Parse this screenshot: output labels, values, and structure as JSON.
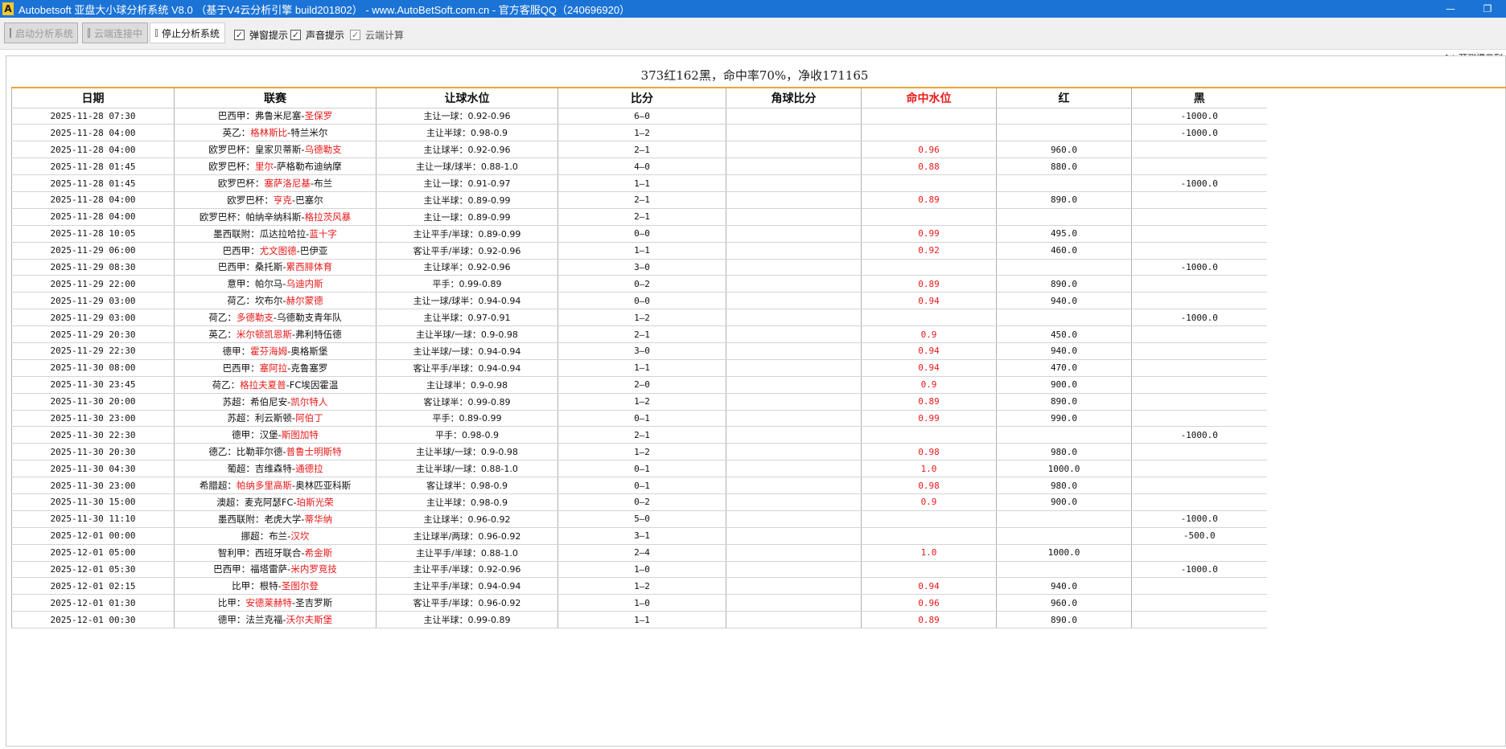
{
  "window": {
    "icon_letter": "A",
    "title": "Autobetsoft 亚盘大小球分析系统 V8.0  （基于V4云分析引擎 build201802） - www.AutoBetSoft.com.cn - 官方客服QQ（240696920）",
    "minimize_glyph": "—",
    "restore_glyph": "❐"
  },
  "toolbar": {
    "start_label": "启动分析系统",
    "cloud_label": "云端连接中",
    "stop_label": "停止分析系统",
    "popup_label": "弹窗提示",
    "sound_label": "声音提示",
    "cloud_calc_label": "云端计算"
  },
  "hint_text": "[ * 预测提示列",
  "summary": "373红162黑，命中率70%，净收171165",
  "columns": [
    "日期",
    "联赛",
    "让球水位",
    "比分",
    "角球比分",
    "命中水位",
    "红",
    "黑"
  ],
  "rows": [
    {
      "date": "2025-11-28 07:30",
      "league": "巴西甲：",
      "home": "弗鲁米尼塞",
      "away": "圣保罗",
      "red": "away",
      "handicap": "主让一球：0.92-0.96",
      "score": "6—0",
      "hit": "",
      "win": "",
      "loss": "-1000.0"
    },
    {
      "date": "2025-11-28 04:00",
      "league": "英乙：",
      "home": "格林斯比",
      "away": "特兰米尔",
      "red": "home",
      "handicap": "主让半球：0.98-0.9",
      "score": "1—2",
      "hit": "",
      "win": "",
      "loss": "-1000.0"
    },
    {
      "date": "2025-11-28 04:00",
      "league": "欧罗巴杯：",
      "home": "皇家贝蒂斯",
      "away": "乌德勒支",
      "red": "away",
      "handicap": "主让球半：0.92-0.96",
      "score": "2—1",
      "hit": "0.96",
      "win": "960.0",
      "loss": ""
    },
    {
      "date": "2025-11-28 01:45",
      "league": "欧罗巴杯：",
      "home": "里尔",
      "away": "萨格勒布迪纳摩",
      "red": "home",
      "handicap": "主让一球/球半：0.88-1.0",
      "score": "4—0",
      "hit": "0.88",
      "win": "880.0",
      "loss": ""
    },
    {
      "date": "2025-11-28 01:45",
      "league": "欧罗巴杯：",
      "home": "塞萨洛尼基",
      "away": "布兰",
      "red": "home",
      "handicap": "主让一球：0.91-0.97",
      "score": "1—1",
      "hit": "",
      "win": "",
      "loss": "-1000.0"
    },
    {
      "date": "2025-11-28 04:00",
      "league": "欧罗巴杯：",
      "home": "亨克",
      "away": "巴塞尔",
      "red": "home",
      "handicap": "主让半球：0.89-0.99",
      "score": "2—1",
      "hit": "0.89",
      "win": "890.0",
      "loss": ""
    },
    {
      "date": "2025-11-28 04:00",
      "league": "欧罗巴杯：",
      "home": "帕纳辛纳科斯",
      "away": "格拉茨风暴",
      "red": "away",
      "handicap": "主让一球：0.89-0.99",
      "score": "2—1",
      "hit": "",
      "win": "",
      "loss": ""
    },
    {
      "date": "2025-11-28 10:05",
      "league": "墨西联附：",
      "home": "瓜达拉哈拉",
      "away": "蓝十字",
      "red": "away",
      "handicap": "主让平手/半球：0.89-0.99",
      "score": "0—0",
      "hit": "0.99",
      "win": "495.0",
      "loss": ""
    },
    {
      "date": "2025-11-29 06:00",
      "league": "巴西甲：",
      "home": "尤文图德",
      "away": "巴伊亚",
      "red": "home",
      "handicap": "客让平手/半球：0.92-0.96",
      "score": "1—1",
      "hit": "0.92",
      "win": "460.0",
      "loss": ""
    },
    {
      "date": "2025-11-29 08:30",
      "league": "巴西甲：",
      "home": "桑托斯",
      "away": "累西腓体育",
      "red": "away",
      "handicap": "主让球半：0.92-0.96",
      "score": "3—0",
      "hit": "",
      "win": "",
      "loss": "-1000.0"
    },
    {
      "date": "2025-11-29 22:00",
      "league": "意甲：",
      "home": "帕尔马",
      "away": "乌迪内斯",
      "red": "away",
      "handicap": "平手：0.99-0.89",
      "score": "0—2",
      "hit": "0.89",
      "win": "890.0",
      "loss": ""
    },
    {
      "date": "2025-11-29 03:00",
      "league": "荷乙：",
      "home": "坎布尔",
      "away": "赫尔蒙德",
      "red": "away",
      "handicap": "主让一球/球半：0.94-0.94",
      "score": "0—0",
      "hit": "0.94",
      "win": "940.0",
      "loss": ""
    },
    {
      "date": "2025-11-29 03:00",
      "league": "荷乙：",
      "home": "多德勒支",
      "away": "乌德勒支青年队",
      "red": "home",
      "handicap": "主让半球：0.97-0.91",
      "score": "1—2",
      "hit": "",
      "win": "",
      "loss": "-1000.0"
    },
    {
      "date": "2025-11-29 20:30",
      "league": "英乙：",
      "home": "米尔顿凯恩斯",
      "away": "弗利特伍德",
      "red": "home",
      "handicap": "主让半球/一球：0.9-0.98",
      "score": "2—1",
      "hit": "0.9",
      "win": "450.0",
      "loss": ""
    },
    {
      "date": "2025-11-29 22:30",
      "league": "德甲：",
      "home": "霍芬海姆",
      "away": "奥格斯堡",
      "red": "home",
      "handicap": "主让半球/一球：0.94-0.94",
      "score": "3—0",
      "hit": "0.94",
      "win": "940.0",
      "loss": ""
    },
    {
      "date": "2025-11-30 08:00",
      "league": "巴西甲：",
      "home": "塞阿拉",
      "away": "克鲁塞罗",
      "red": "home",
      "handicap": "客让平手/半球：0.94-0.94",
      "score": "1—1",
      "hit": "0.94",
      "win": "470.0",
      "loss": ""
    },
    {
      "date": "2025-11-30 23:45",
      "league": "荷乙：",
      "home": "格拉夫夏普",
      "away": "FC埃因霍温",
      "red": "home",
      "handicap": "主让球半：0.9-0.98",
      "score": "2—0",
      "hit": "0.9",
      "win": "900.0",
      "loss": ""
    },
    {
      "date": "2025-11-30 20:00",
      "league": "苏超：",
      "home": "希伯尼安",
      "away": "凯尔特人",
      "red": "away",
      "handicap": "客让球半：0.99-0.89",
      "score": "1—2",
      "hit": "0.89",
      "win": "890.0",
      "loss": ""
    },
    {
      "date": "2025-11-30 23:00",
      "league": "苏超：",
      "home": "利云斯顿",
      "away": "阿伯丁",
      "red": "away",
      "handicap": "平手：0.89-0.99",
      "score": "0—1",
      "hit": "0.99",
      "win": "990.0",
      "loss": ""
    },
    {
      "date": "2025-11-30 22:30",
      "league": "德甲：",
      "home": "汉堡",
      "away": "斯图加特",
      "red": "away",
      "handicap": "平手：0.98-0.9",
      "score": "2—1",
      "hit": "",
      "win": "",
      "loss": "-1000.0"
    },
    {
      "date": "2025-11-30 20:30",
      "league": "德乙：",
      "home": "比勒菲尔德",
      "away": "普鲁士明斯特",
      "red": "away",
      "handicap": "主让半球/一球：0.9-0.98",
      "score": "1—2",
      "hit": "0.98",
      "win": "980.0",
      "loss": ""
    },
    {
      "date": "2025-11-30 04:30",
      "league": "葡超：",
      "home": "吉维森特",
      "away": "通德拉",
      "red": "away",
      "handicap": "主让半球/一球：0.88-1.0",
      "score": "0—1",
      "hit": "1.0",
      "win": "1000.0",
      "loss": ""
    },
    {
      "date": "2025-11-30 23:00",
      "league": "希腊超：",
      "home": "帕纳多里高斯",
      "away": "奥林匹亚科斯",
      "red": "home",
      "handicap": "客让球半：0.98-0.9",
      "score": "0—1",
      "hit": "0.98",
      "win": "980.0",
      "loss": ""
    },
    {
      "date": "2025-11-30 15:00",
      "league": "澳超：",
      "home": "麦克阿瑟FC",
      "away": "珀斯光荣",
      "red": "away",
      "handicap": "主让半球：0.98-0.9",
      "score": "0—2",
      "hit": "0.9",
      "win": "900.0",
      "loss": ""
    },
    {
      "date": "2025-11-30 11:10",
      "league": "墨西联附：",
      "home": "老虎大学",
      "away": "蒂华纳",
      "red": "away",
      "handicap": "主让球半：0.96-0.92",
      "score": "5—0",
      "hit": "",
      "win": "",
      "loss": "-1000.0"
    },
    {
      "date": "2025-12-01 00:00",
      "league": "挪超：",
      "home": "布兰",
      "away": "汉坎",
      "red": "away",
      "handicap": "主让球半/两球：0.96-0.92",
      "score": "3—1",
      "hit": "",
      "win": "",
      "loss": "-500.0"
    },
    {
      "date": "2025-12-01 05:00",
      "league": "智利甲：",
      "home": "西班牙联合",
      "away": "希金斯",
      "red": "away",
      "handicap": "主让平手/半球：0.88-1.0",
      "score": "2—4",
      "hit": "1.0",
      "win": "1000.0",
      "loss": ""
    },
    {
      "date": "2025-12-01 05:30",
      "league": "巴西甲：",
      "home": "福塔雷萨",
      "away": "米内罗竞技",
      "red": "away",
      "handicap": "主让平手/半球：0.92-0.96",
      "score": "1—0",
      "hit": "",
      "win": "",
      "loss": "-1000.0"
    },
    {
      "date": "2025-12-01 02:15",
      "league": "比甲：",
      "home": "根特",
      "away": "圣图尔登",
      "red": "away",
      "handicap": "主让平手/半球：0.94-0.94",
      "score": "1—2",
      "hit": "0.94",
      "win": "940.0",
      "loss": ""
    },
    {
      "date": "2025-12-01 01:30",
      "league": "比甲：",
      "home": "安德莱赫特",
      "away": "圣吉罗斯",
      "red": "home",
      "handicap": "客让平手/半球：0.96-0.92",
      "score": "1—0",
      "hit": "0.96",
      "win": "960.0",
      "loss": ""
    },
    {
      "date": "2025-12-01 00:30",
      "league": "德甲：",
      "home": "法兰克福",
      "away": "沃尔夫斯堡",
      "red": "away",
      "handicap": "主让半球：0.99-0.89",
      "score": "1—1",
      "hit": "0.89",
      "win": "890.0",
      "loss": ""
    }
  ]
}
